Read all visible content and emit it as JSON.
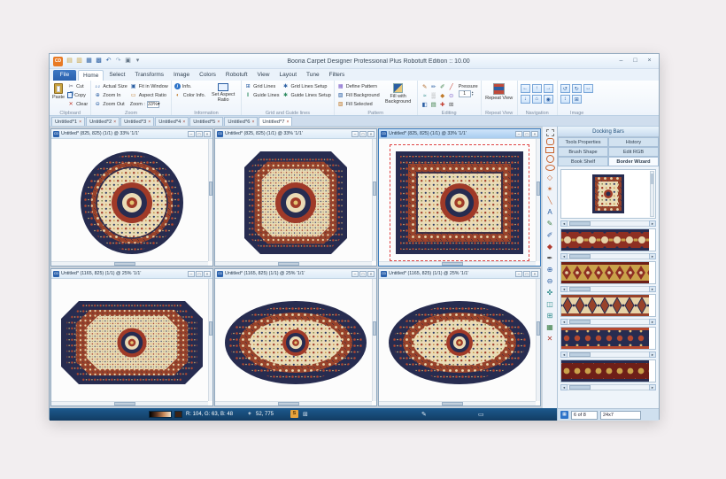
{
  "window": {
    "title": "Booria Carpet Designer Professional Plus Robotuft Edition :: 10.00",
    "app_badge": "CD"
  },
  "qat": [
    {
      "name": "new-document-icon",
      "glyph": "▤",
      "style": "color:#c9a23f"
    },
    {
      "name": "open-icon",
      "glyph": "▥",
      "style": "color:#c9a23f"
    },
    {
      "name": "save-icon",
      "glyph": "▦",
      "style": "color:#2b5fa3"
    },
    {
      "name": "save-all-icon",
      "glyph": "▩",
      "style": "color:#2b5fa3"
    },
    {
      "name": "undo-icon",
      "glyph": "↶",
      "style": "color:#2b5fa3"
    },
    {
      "name": "redo-icon",
      "glyph": "↷",
      "style": "color:#8aa4c0"
    },
    {
      "name": "print-icon",
      "glyph": "▣",
      "style": "color:#667788"
    },
    {
      "name": "qat-menu-icon",
      "glyph": "▾",
      "style": "color:#667788"
    }
  ],
  "ribbon": {
    "file_tab": "File",
    "tabs": [
      {
        "label": "Home",
        "name": "tab-home",
        "cls": "rtab active"
      },
      {
        "label": "Select",
        "name": "tab-select",
        "cls": "rtab"
      },
      {
        "label": "Transforms",
        "name": "tab-transforms",
        "cls": "rtab"
      },
      {
        "label": "Image",
        "name": "tab-image",
        "cls": "rtab"
      },
      {
        "label": "Colors",
        "name": "tab-colors",
        "cls": "rtab"
      },
      {
        "label": "Robotuft",
        "name": "tab-robotuft",
        "cls": "rtab"
      },
      {
        "label": "View",
        "name": "tab-view",
        "cls": "rtab"
      },
      {
        "label": "Layout",
        "name": "tab-layout",
        "cls": "rtab"
      },
      {
        "label": "Tune",
        "name": "tab-tune",
        "cls": "rtab"
      },
      {
        "label": "Filters",
        "name": "tab-filters",
        "cls": "rtab"
      }
    ],
    "clipboard": {
      "label": "Clipboard",
      "paste": "Paste",
      "cut": "Cut",
      "copy": "Copy",
      "clear": "Clear"
    },
    "zoom": {
      "label": "Zoom",
      "actual": "Actual Size",
      "zoom_in": "Zoom In",
      "zoom_out": "Zoom Out",
      "fit": "Fit in Window",
      "aspect": "Aspect Ratio",
      "combo_label": "Zoom :",
      "combo_value": "33%",
      "combo_arrow": "▾"
    },
    "information": {
      "label": "Information",
      "info": "Info.",
      "color_info": "Color Info.",
      "set_aspect": "Set Aspect Ratio"
    },
    "grid": {
      "label": "Grid and Guide lines",
      "grid_lines": "Grid Lines",
      "guide_lines": "Guide Lines",
      "grid_setup": "Grid Lines Setup",
      "guide_setup": "Guide Lines Setup"
    },
    "pattern": {
      "label": "Pattern",
      "define": "Define Pattern",
      "fill_bg": "Fill Background",
      "fill_sel": "Fill Selected",
      "fill_with_bg": "Fill with Background"
    },
    "editing": {
      "label": "Editing",
      "pressure": "Pressure",
      "pressure_value": "1",
      "tools": [
        {
          "name": "pencil-icon",
          "glyph": "✎",
          "style": "color:#b06a2a"
        },
        {
          "name": "brush-icon",
          "glyph": "✏",
          "style": "color:#2b5fa3"
        },
        {
          "name": "airbrush-icon",
          "glyph": "✐",
          "style": "color:#3a7d44"
        },
        {
          "name": "line-icon",
          "glyph": "╱",
          "style": "color:#c0392b"
        },
        {
          "name": "curve-icon",
          "glyph": "≈",
          "style": "color:#2b8a8a"
        },
        {
          "name": "eraser-icon",
          "glyph": "▒",
          "style": "color:#888888"
        },
        {
          "name": "fill-icon",
          "glyph": "◆",
          "style": "color:#c07a2a"
        },
        {
          "name": "clone-icon",
          "glyph": "⊙",
          "style": "color:#7a5ac8"
        },
        {
          "name": "mirror-icon",
          "glyph": "◧",
          "style": "color:#2b5fa3"
        },
        {
          "name": "pattern-brush-icon",
          "glyph": "▤",
          "style": "color:#3a7d44"
        },
        {
          "name": "add-point-icon",
          "glyph": "✚",
          "style": "color:#c0392b"
        },
        {
          "name": "grid-brush-icon",
          "glyph": "⊞",
          "style": "color:#555555"
        }
      ]
    },
    "repeat_view": {
      "label": "Repeat View",
      "button": "Repeat View"
    },
    "navigation": {
      "label": "Navigation",
      "buttons": [
        {
          "name": "nav-left-icon",
          "glyph": "←"
        },
        {
          "name": "nav-up-icon",
          "glyph": "↑"
        },
        {
          "name": "nav-right-icon",
          "glyph": "→"
        },
        {
          "name": "nav-down-icon",
          "glyph": "↓"
        },
        {
          "name": "nav-home-icon",
          "glyph": "⌂"
        },
        {
          "name": "nav-center-icon",
          "glyph": "◉"
        }
      ]
    },
    "image_group": {
      "label": "Image",
      "buttons": [
        {
          "name": "rotate-left-icon",
          "glyph": "↺"
        },
        {
          "name": "rotate-right-icon",
          "glyph": "↻"
        },
        {
          "name": "flip-horizontal-icon",
          "glyph": "↔"
        },
        {
          "name": "flip-vertical-icon",
          "glyph": "↕"
        },
        {
          "name": "resize-icon",
          "glyph": "⊞"
        }
      ]
    }
  },
  "doctabs": {
    "close_glyph": "×",
    "tabs": [
      {
        "label": "Untitled*1",
        "name": "document-tab-1",
        "cls": "dtab"
      },
      {
        "label": "Untitled*2",
        "name": "document-tab-2",
        "cls": "dtab"
      },
      {
        "label": "Untitled*3",
        "name": "document-tab-3",
        "cls": "dtab"
      },
      {
        "label": "Untitled*4",
        "name": "document-tab-4",
        "cls": "dtab"
      },
      {
        "label": "Untitled*5",
        "name": "document-tab-5",
        "cls": "dtab"
      },
      {
        "label": "Untitled*6",
        "name": "document-tab-6",
        "cls": "dtab"
      },
      {
        "label": "Untitled*7",
        "name": "document-tab-7",
        "cls": "dtab active"
      }
    ]
  },
  "mdi": {
    "badge": "CD",
    "windows": [
      {
        "title": "Untitled* (825, 825) (1/1) @ 33% '1/1'"
      },
      {
        "title": "Untitled* (825, 825) (1/1) @ 33% '1/1'"
      },
      {
        "title": "Untitled* (825, 825) (1/1) @ 33% '1/1'"
      },
      {
        "title": "Untitled* (1165, 825) (1/1) @ 25% '1/1'"
      },
      {
        "title": "Untitled* (1165, 825) (1/1) @ 25% '1/1'"
      },
      {
        "title": "Untitled* (1165, 825) (1/1) @ 25% '1/1'"
      }
    ]
  },
  "toolbox": {
    "tools": [
      {
        "name": "select-tool",
        "glyph": "",
        "cls": "ticon sh-dash",
        "style": "color:#777777"
      },
      {
        "name": "rounded-rect-tool",
        "glyph": "",
        "cls": "ticon sh-round",
        "style": "color:#c8622d"
      },
      {
        "name": "rectangle-tool",
        "glyph": "",
        "cls": "ticon sh-rect",
        "style": "color:#c8622d"
      },
      {
        "name": "circle-tool",
        "glyph": "",
        "cls": "ticon sh-circle",
        "style": "color:#c8622d"
      },
      {
        "name": "ellipse-tool",
        "glyph": "",
        "cls": "ticon sh-ellipse",
        "style": "color:#c8622d"
      },
      {
        "name": "diamond-tool",
        "glyph": "◇",
        "cls": "ticon",
        "style": "color:#c8622d"
      },
      {
        "name": "star-tool",
        "glyph": "✶",
        "cls": "ticon",
        "style": "color:#c8622d"
      },
      {
        "name": "line-tool",
        "glyph": "╲",
        "cls": "ticon",
        "style": "color:#c8622d"
      },
      {
        "name": "text-tool",
        "glyph": "A",
        "cls": "ticon",
        "style": "color:#2b5fa3"
      },
      {
        "name": "pencil-tool",
        "glyph": "✎",
        "cls": "ticon",
        "style": "color:#3a7d44"
      },
      {
        "name": "brush-tool",
        "glyph": "✐",
        "cls": "ticon",
        "style": "color:#2b5fa3"
      },
      {
        "name": "fill-tool",
        "glyph": "◆",
        "cls": "ticon",
        "style": "color:#b03a2e"
      },
      {
        "name": "eyedropper-tool",
        "glyph": "✒",
        "cls": "ticon",
        "style": "color:#444444"
      },
      {
        "name": "zoom-in-tool",
        "glyph": "⊕",
        "cls": "ticon",
        "style": "color:#2b5fa3"
      },
      {
        "name": "zoom-out-tool",
        "glyph": "⊖",
        "cls": "ticon",
        "style": "color:#2b5fa3"
      },
      {
        "name": "pan-tool",
        "glyph": "✜",
        "cls": "ticon",
        "style": "color:#2b8a8a"
      },
      {
        "name": "mirror-tool",
        "glyph": "◫",
        "cls": "ticon",
        "style": "color:#2b8a8a"
      },
      {
        "name": "grid-tool",
        "glyph": "⊞",
        "cls": "ticon",
        "style": "color:#2b8a8a"
      },
      {
        "name": "repeat-tool",
        "glyph": "▦",
        "cls": "ticon",
        "style": "color:#3a7d44"
      },
      {
        "name": "delete-tool",
        "glyph": "✕",
        "cls": "ticon",
        "style": "color:#b03a2e"
      }
    ]
  },
  "dock": {
    "header": "Docking Bars",
    "tabs": [
      {
        "label": "Tools Properties",
        "name": "dock-tab-tools-properties",
        "cls": "dktab"
      },
      {
        "label": "History",
        "name": "dock-tab-history",
        "cls": "dktab"
      },
      {
        "label": "Brush Shape",
        "name": "dock-tab-brush-shape",
        "cls": "dktab"
      },
      {
        "label": "Edit RGB",
        "name": "dock-tab-edit-rgb",
        "cls": "dktab"
      },
      {
        "label": "Book Shelf",
        "name": "dock-tab-book-shelf",
        "cls": "dktab"
      },
      {
        "label": "Border Wizard",
        "name": "dock-tab-border-wizard",
        "cls": "dktab active"
      }
    ],
    "footer": {
      "page": "6 of 8",
      "size": "24x7"
    }
  },
  "statusbar": {
    "rgb": "R: 104, G: 63, B: 48",
    "crosshair": "+",
    "coords": "52, 775",
    "badge": "S"
  },
  "colors": {
    "accent_blue": "#2b62ad",
    "status_bar": "#17497d",
    "carpet_navy": "#272c50",
    "carpet_rust": "#98422a",
    "carpet_cream": "#eadbb6",
    "carpet_red": "#a03a28",
    "carpet_gold": "#caa24a"
  }
}
